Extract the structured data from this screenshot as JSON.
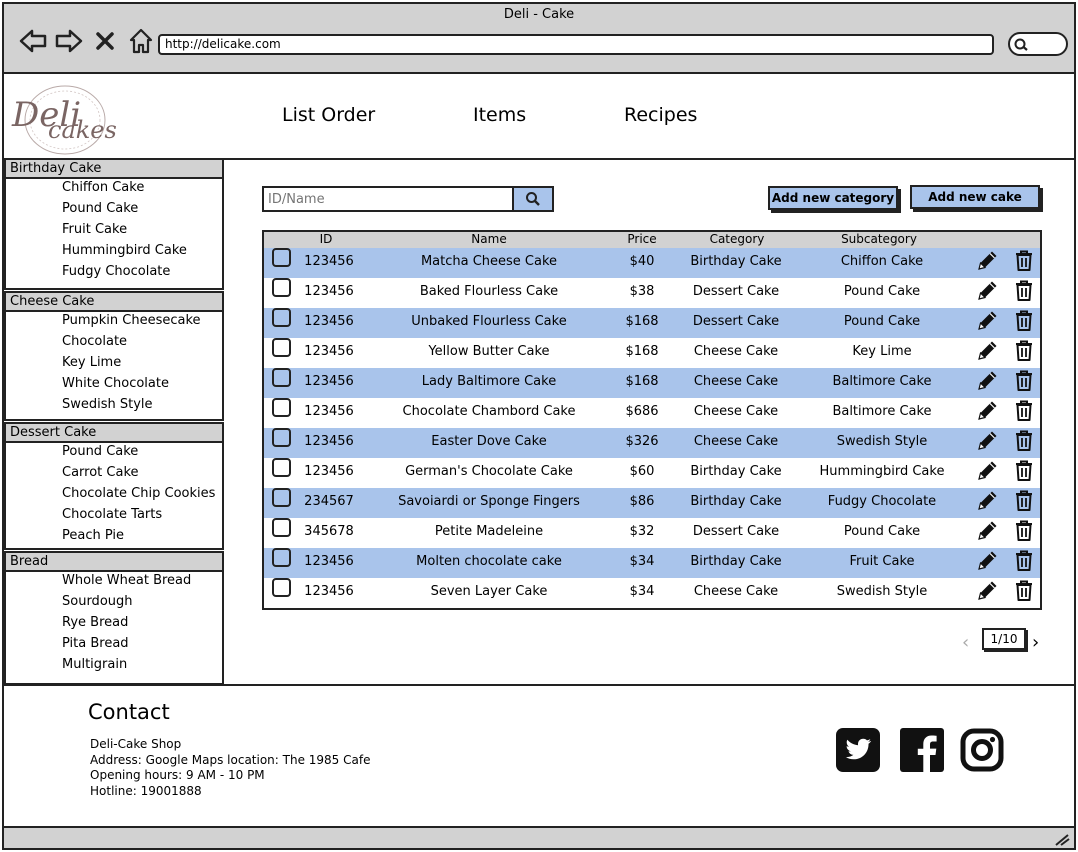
{
  "window": {
    "title": "Deli - Cake",
    "url": "http://delicake.com"
  },
  "logo": {
    "text_top": "Deli",
    "text_bottom": "cakes"
  },
  "top_nav": [
    "List Order",
    "Items",
    "Recipes"
  ],
  "sidebar": [
    {
      "title": "Birthday Cake",
      "items": [
        "Chiffon Cake",
        "Pound Cake",
        "Fruit Cake",
        "Hummingbird Cake",
        "Fudgy Chocolate"
      ]
    },
    {
      "title": "Cheese Cake",
      "items": [
        "Pumpkin Cheesecake",
        "Chocolate",
        "Key Lime",
        "White Chocolate",
        "Swedish Style"
      ]
    },
    {
      "title": "Dessert Cake",
      "items": [
        "Pound Cake",
        "Carrot Cake",
        "Chocolate Chip Cookies",
        "Chocolate Tarts",
        "Peach Pie"
      ]
    },
    {
      "title": "Bread",
      "items": [
        "Whole Wheat Bread",
        "Sourdough",
        "Rye Bread",
        "Pita Bread",
        "Multigrain"
      ]
    }
  ],
  "search": {
    "placeholder": "ID/Name"
  },
  "buttons": {
    "add_category": "Add new category",
    "add_cake": "Add new cake"
  },
  "table": {
    "columns": [
      "ID",
      "Name",
      "Price",
      "Category",
      "Subcategory"
    ],
    "rows": [
      [
        "123456",
        "Matcha Cheese Cake",
        "$40",
        "Birthday Cake",
        "Chiffon Cake"
      ],
      [
        "123456",
        "Baked Flourless Cake",
        "$38",
        "Dessert Cake",
        "Pound Cake"
      ],
      [
        "123456",
        "Unbaked Flourless Cake",
        "$168",
        "Dessert Cake",
        "Pound Cake"
      ],
      [
        "123456",
        "Yellow Butter Cake",
        "$168",
        "Cheese Cake",
        "Key Lime"
      ],
      [
        "123456",
        "Lady Baltimore Cake",
        "$168",
        "Cheese Cake",
        "Baltimore Cake"
      ],
      [
        "123456",
        "Chocolate Chambord Cake",
        "$686",
        "Cheese Cake",
        "Baltimore Cake"
      ],
      [
        "123456",
        "Easter Dove Cake",
        "$326",
        "Cheese Cake",
        "Swedish Style"
      ],
      [
        "123456",
        "German's Chocolate Cake",
        "$60",
        "Birthday Cake",
        "Hummingbird Cake"
      ],
      [
        "234567",
        "Savoiardi or Sponge Fingers",
        "$86",
        "Birthday Cake",
        "Fudgy Chocolate"
      ],
      [
        "345678",
        "Petite Madeleine",
        "$32",
        "Dessert Cake",
        "Pound Cake"
      ],
      [
        "123456",
        "Molten chocolate cake",
        "$34",
        "Birthday Cake",
        "Fruit Cake"
      ],
      [
        "123456",
        "Seven Layer Cake",
        "$34",
        "Cheese Cake",
        "Swedish Style"
      ]
    ]
  },
  "pagination": {
    "label": "1/10"
  },
  "contact": {
    "title": "Contact",
    "lines": [
      "Deli-Cake Shop",
      "Address: Google Maps location: The 1985 Cafe",
      "Opening hours: 9 AM - 10 PM",
      "Hotline: 19001888"
    ]
  },
  "social": [
    "twitter-icon",
    "facebook-icon",
    "instagram-icon"
  ],
  "colors": {
    "accent": "#a9c4eb",
    "chrome": "#d2d2d2",
    "border": "#222222"
  }
}
